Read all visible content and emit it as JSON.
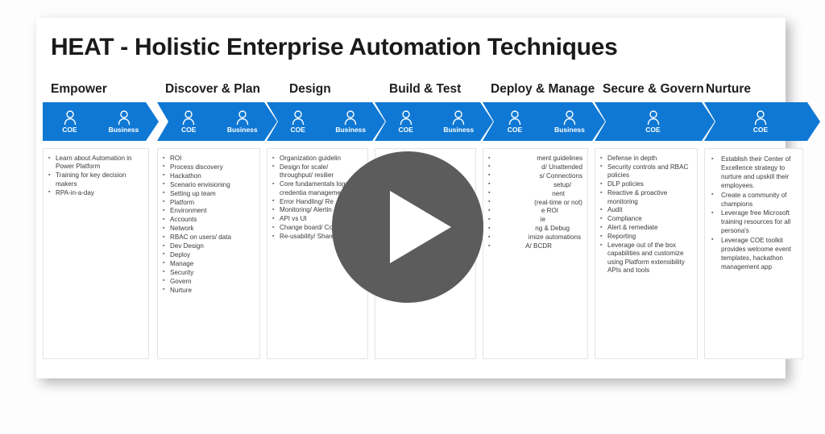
{
  "slide": {
    "title": "HEAT - Holistic Enterprise Automation Techniques"
  },
  "personas": {
    "coe": "COE",
    "business": "Business"
  },
  "player": {
    "play_label": "Play"
  },
  "columns": [
    {
      "phase": "Empower",
      "personas": [
        "COE",
        "Business"
      ],
      "bullets": [
        "Learn about Automation in Power Platform",
        "Training for key decision makers",
        "RPA-in-a-day"
      ]
    },
    {
      "phase": "Discover & Plan",
      "personas": [
        "COE",
        "Business"
      ],
      "bullets": [
        "ROI",
        "Process discovery",
        "Hackathon",
        "Scenario envisioning",
        "Setting up team",
        "Platform",
        "Environment",
        "Accounts",
        "Network",
        "RBAC on users/ data",
        "Dev Design",
        "Deploy",
        "Manage",
        "Security",
        "Govern",
        "Nurture"
      ]
    },
    {
      "phase": "Design",
      "personas": [
        "COE",
        "Business"
      ],
      "bullets": [
        "Organization guidelin",
        "Design for scale/ throughput/ resilier",
        "Core fundamentals logging/ credentia management/ test",
        "Error Handling/ Re",
        "Monitoring/ Alertin",
        "API vs UI",
        "Change board/ Code review",
        "Re-usability/ Share"
      ]
    },
    {
      "phase": "Build & Test",
      "personas": [
        "COE",
        "Business"
      ],
      "bullets": []
    },
    {
      "phase": "Deploy & Manage",
      "personas": [
        "COE",
        "Business"
      ],
      "bullets": [
        "ment guidelines",
        "d/ Unattended",
        "s/ Connections",
        "setup/",
        "nent",
        "(real-time or not)",
        "e ROI",
        "ie",
        "ng & Debug",
        "imize automations",
        "A/ BCDR"
      ]
    },
    {
      "phase": "Secure & Govern",
      "personas": [
        "COE"
      ],
      "bullets": [
        "Defense in depth",
        "Security controls and RBAC policies",
        "DLP policies",
        "Reactive & proactive monitoring",
        "Audit",
        "Compliance",
        "Alert & remediate",
        "Reporting",
        "Leverage out of the box capabilities and customize using Platform extensibility APIs and tools"
      ]
    },
    {
      "phase": "Nurture",
      "personas": [
        "COE"
      ],
      "bullets": [
        "Establish their Center of Excellence strategy to nurture and upskill their employees.",
        "Create a community of champions",
        "Leverage free Microsoft training resources for all persona's",
        "Leverage COE toolkit provides welcome event templates, hackathon management app"
      ]
    }
  ],
  "colors": {
    "chevron_blue": "#0F78D4",
    "play_gray": "#5C5C5C",
    "title_text": "#1A1A1A",
    "bullet_text": "#3A3A3A",
    "card_border": "#E4E4E4"
  }
}
